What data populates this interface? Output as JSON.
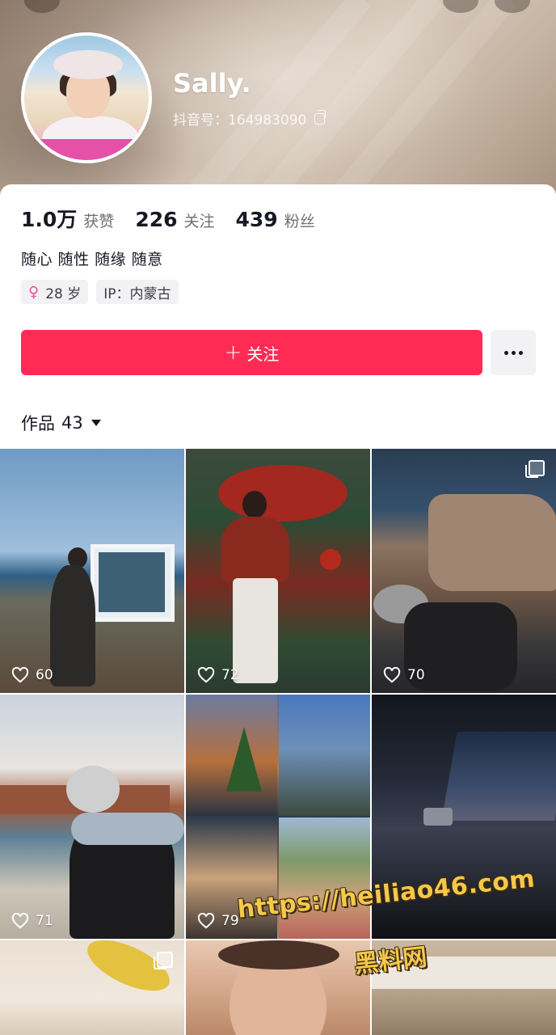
{
  "profile": {
    "name": "Sally.",
    "douyin_id": "抖音号：164983090",
    "bio": "随心 随性 随缘 随意",
    "stats": [
      {
        "num": "1.0万",
        "label": "获赞"
      },
      {
        "num": "226",
        "label": "关注"
      },
      {
        "num": "439",
        "label": "粉丝"
      }
    ],
    "tags": {
      "age": "28 岁",
      "ip": "IP：内蒙古"
    }
  },
  "actions": {
    "follow_label": "关注",
    "follow_plus": "+"
  },
  "works": {
    "label": "作品",
    "count": "43"
  },
  "grid": [
    {
      "likes": "60"
    },
    {
      "likes": "72"
    },
    {
      "likes": "70"
    },
    {
      "likes": "71"
    },
    {
      "likes": "79"
    }
  ],
  "watermark": {
    "url": "https://heiliao46.com",
    "name": "黑料网"
  },
  "colors": {
    "accent": "#fe2c55",
    "watermark": "#f5c84a"
  }
}
